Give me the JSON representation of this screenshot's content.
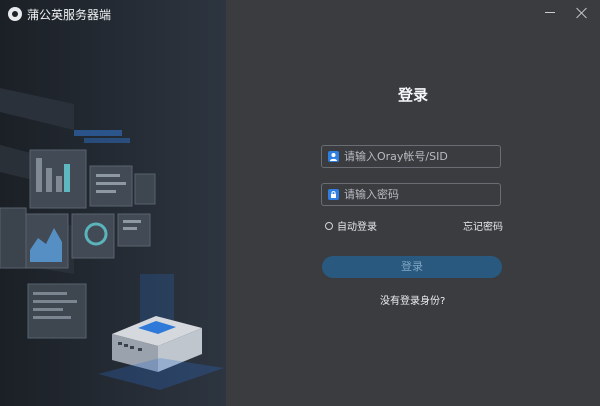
{
  "window": {
    "title": "蒲公英服务器端"
  },
  "login": {
    "heading": "登录",
    "username_placeholder": "请输入Oray帐号/SID",
    "password_placeholder": "请输入密码",
    "remember_label": "自动登录",
    "forgot_label": "忘记密码",
    "login_button": "登录",
    "no_account_link": "没有登录身份?"
  }
}
